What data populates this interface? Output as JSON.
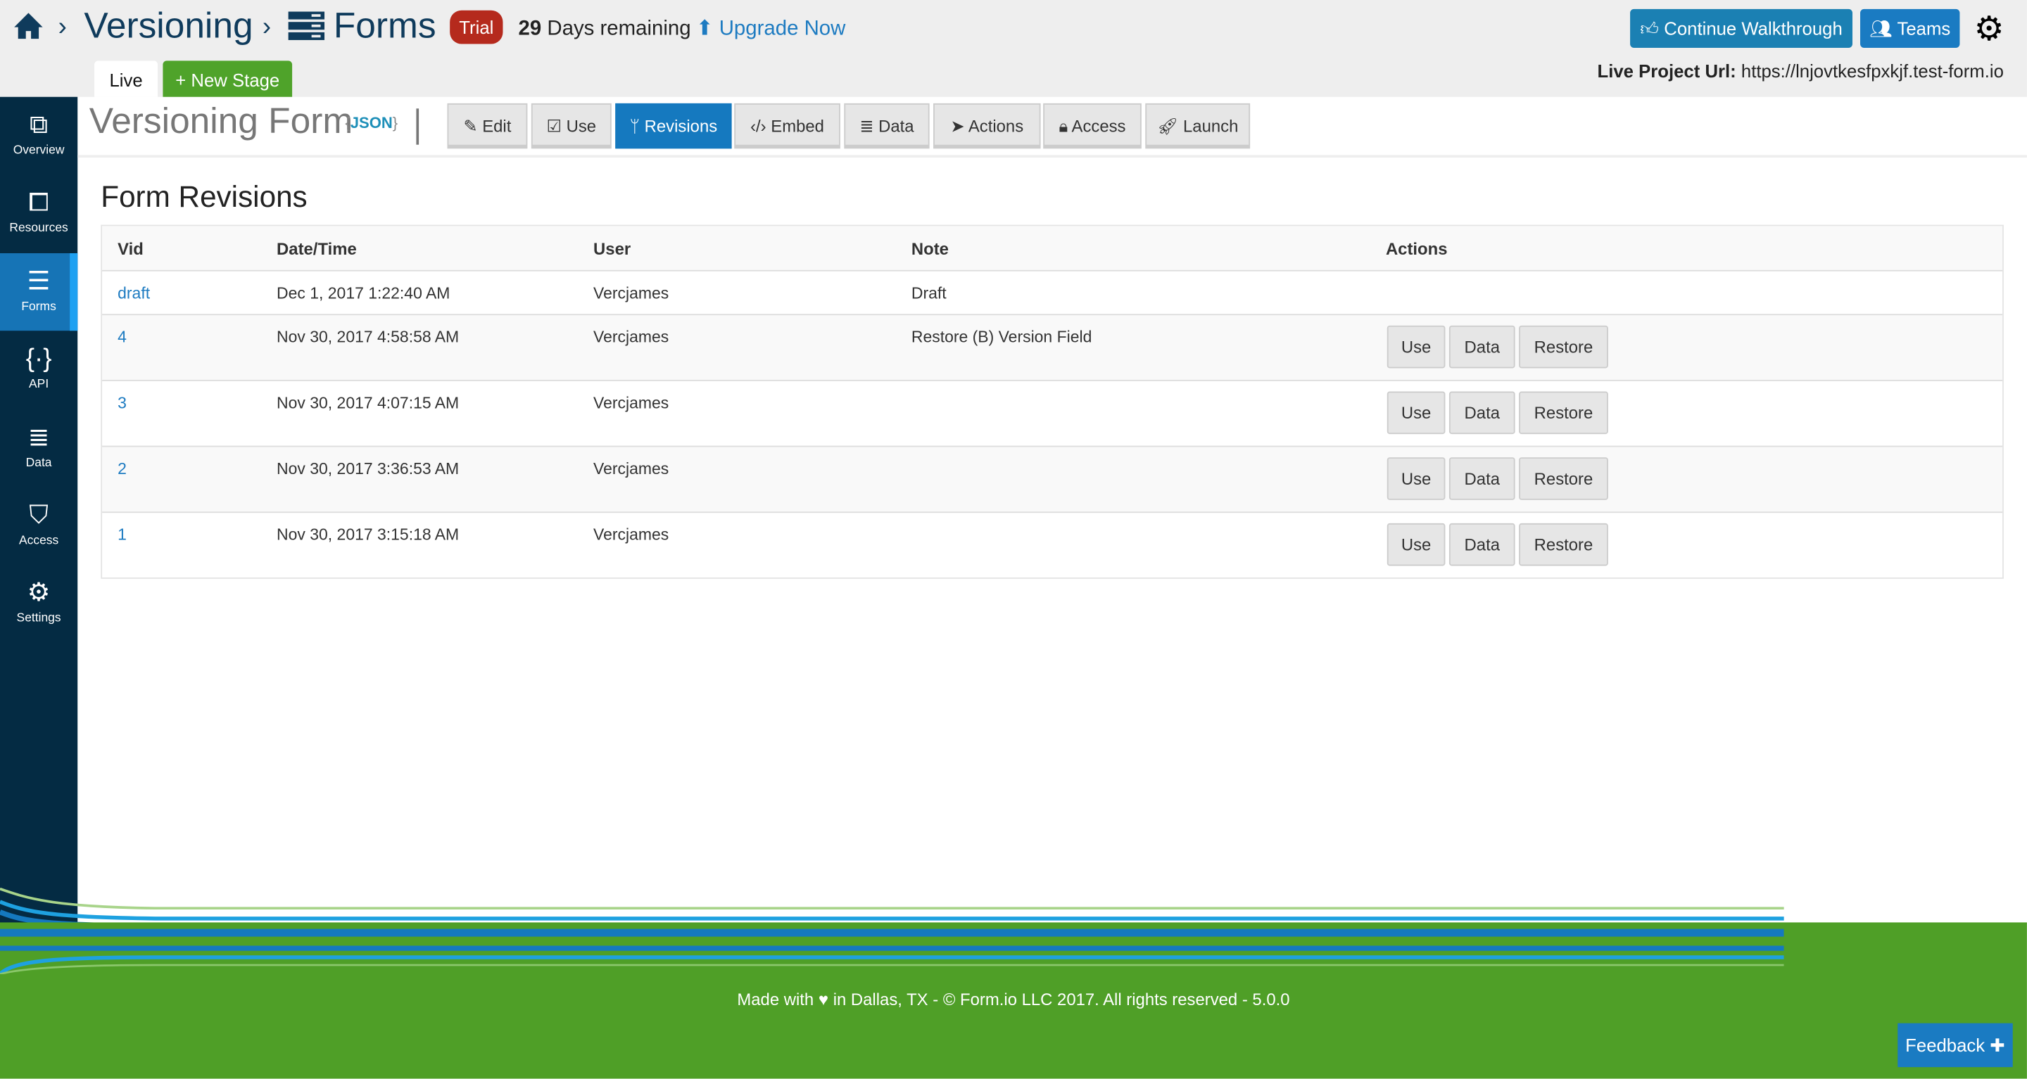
{
  "header": {
    "breadcrumb": [
      "Versioning",
      "Forms"
    ],
    "separator": "›",
    "trial_badge": "Trial",
    "days_number": "29",
    "days_text": "Days remaining",
    "upgrade": "Upgrade Now",
    "continue_walkthrough": "Continue Walkthrough",
    "teams": "Teams",
    "live_project_label": "Live Project Url:",
    "live_project_url": "https://lnjovtkesfpxkjf.test-form.io"
  },
  "stages": {
    "live": "Live",
    "new_stage": "+ New Stage"
  },
  "sidebar": {
    "items": [
      {
        "label": "Overview",
        "icon": "sitemap-icon"
      },
      {
        "label": "Resources",
        "icon": "resources-icon"
      },
      {
        "label": "Forms",
        "icon": "forms-icon",
        "active": true
      },
      {
        "label": "API",
        "icon": "api-icon"
      },
      {
        "label": "Data",
        "icon": "database-icon"
      },
      {
        "label": "Access",
        "icon": "shield-icon"
      },
      {
        "label": "Settings",
        "icon": "gear-icon"
      }
    ]
  },
  "form": {
    "title": "Versioning Form",
    "json_badge": "JSON",
    "nav": [
      "Edit",
      "Use",
      "Revisions",
      "Embed",
      "Data",
      "Actions",
      "Access",
      "Launch"
    ],
    "active_nav": "Revisions"
  },
  "revisions": {
    "title": "Form Revisions",
    "columns": [
      "Vid",
      "Date/Time",
      "User",
      "Note",
      "Actions"
    ],
    "draft": {
      "vid": "draft",
      "date": "Dec 1, 2017 1:22:40 AM",
      "user": "Vercjames",
      "note": "Draft"
    },
    "rows": [
      {
        "vid": "4",
        "date": "Nov 30, 2017 4:58:58 AM",
        "user": "Vercjames",
        "note": "Restore (B) Version Field"
      },
      {
        "vid": "3",
        "date": "Nov 30, 2017 4:07:15 AM",
        "user": "Vercjames",
        "note": ""
      },
      {
        "vid": "2",
        "date": "Nov 30, 2017 3:36:53 AM",
        "user": "Vercjames",
        "note": ""
      },
      {
        "vid": "1",
        "date": "Nov 30, 2017 3:15:18 AM",
        "user": "Vercjames",
        "note": ""
      }
    ],
    "actions": [
      "Use",
      "Data",
      "Restore"
    ]
  },
  "footer": {
    "text_before": "Made with",
    "text_after": "in Dallas, TX - © Form.io LLC 2017. All rights reserved - 5.0.0",
    "feedback": "Feedback"
  },
  "colors": {
    "brand_dark": "#042b43",
    "accent_blue": "#1579bf",
    "green": "#4f9f27",
    "trial_red": "#b52a1d"
  }
}
